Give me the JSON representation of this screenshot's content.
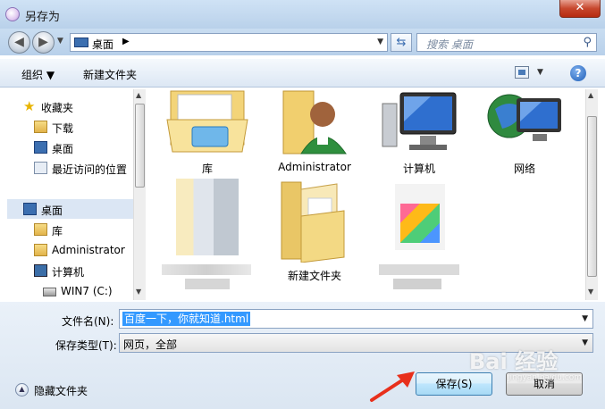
{
  "window": {
    "title": "另存为",
    "close_glyph": "✕"
  },
  "nav": {
    "back_glyph": "◀",
    "forward_glyph": "▶",
    "address_location": "桌面",
    "address_chevron": "▶",
    "search_placeholder": "搜索 桌面"
  },
  "toolbar": {
    "organize": "组织 ▼",
    "new_folder": "新建文件夹",
    "help": "?"
  },
  "sidebar": {
    "items": [
      {
        "label": "收藏夹",
        "icon": "star-icon"
      },
      {
        "label": "下载",
        "icon": "download-folder-icon"
      },
      {
        "label": "桌面",
        "icon": "desktop-icon"
      },
      {
        "label": "最近访问的位置",
        "icon": "recent-places-icon"
      },
      {
        "label": "桌面",
        "icon": "desktop-icon"
      },
      {
        "label": "库",
        "icon": "library-icon"
      },
      {
        "label": "Administrator",
        "icon": "user-folder-icon"
      },
      {
        "label": "计算机",
        "icon": "computer-icon"
      },
      {
        "label": "WIN7 (C:)",
        "icon": "drive-icon"
      }
    ]
  },
  "files": [
    {
      "label": "库",
      "icon": "library-folder-icon"
    },
    {
      "label": "Administrator",
      "icon": "user-folder-icon"
    },
    {
      "label": "计算机",
      "icon": "computer-icon"
    },
    {
      "label": "网络",
      "icon": "network-icon"
    },
    {
      "label": "新建文件夹",
      "icon": "folder-icon"
    }
  ],
  "form": {
    "filename_label": "文件名(N):",
    "filename_value": "百度一下，你就知道.html",
    "filetype_label": "保存类型(T):",
    "filetype_value": "网页，全部",
    "hide_folders": "隐藏文件夹",
    "save_button": "保存(S)",
    "cancel_button": "取消"
  },
  "watermark": {
    "text": "Bai 经验",
    "sub": "jingyan.baidu.com"
  },
  "colors": {
    "selection": "#3399ff",
    "title_bar": "#c4d9ef",
    "arrow": "#e8301c"
  }
}
